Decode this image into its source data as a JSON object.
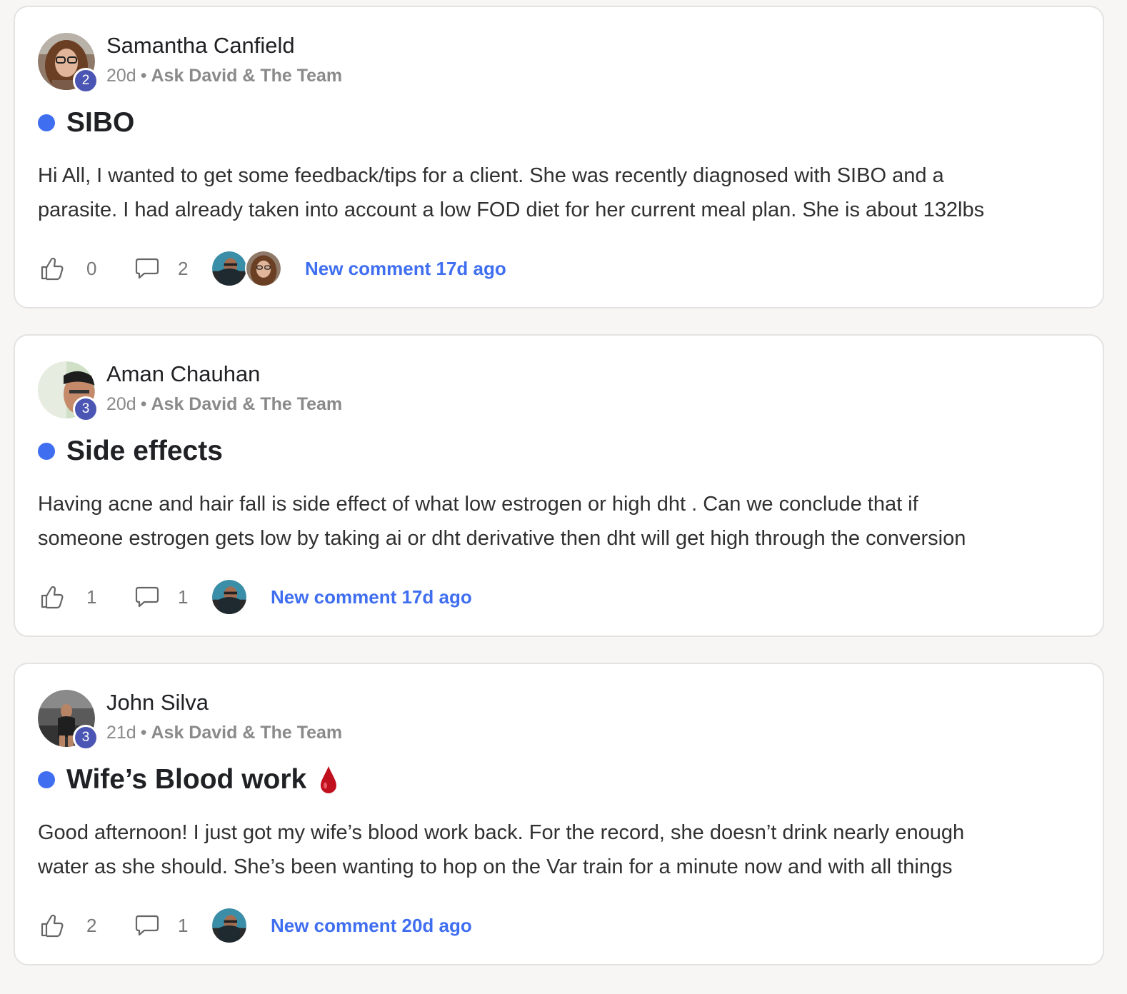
{
  "posts": [
    {
      "author": "Samantha Canfield",
      "level": "2",
      "age": "20d",
      "separator": "•",
      "category": "Ask David & The Team",
      "title": "SIBO",
      "title_emoji": "",
      "body_lines": [
        "Hi All, I wanted to get some feedback/tips for a client. She was recently diagnosed with SIBO and a",
        "parasite. I had already taken into account a low FOD diet for her current meal plan. She is about 132lbs"
      ],
      "likes": "0",
      "comments": "2",
      "commenter_avatars": [
        "avatar-david",
        "avatar-samantha"
      ],
      "new_comment": "New comment 17d ago"
    },
    {
      "author": "Aman Chauhan",
      "level": "3",
      "age": "20d",
      "separator": "•",
      "category": "Ask David & The Team",
      "title": "Side effects",
      "title_emoji": "",
      "body_lines": [
        "Having acne and hair fall is side effect of what low estrogen or high dht . Can we conclude that if",
        "someone estrogen gets low by taking ai or dht derivative then dht will get high through the conversion"
      ],
      "likes": "1",
      "comments": "1",
      "commenter_avatars": [
        "avatar-david"
      ],
      "new_comment": "New comment 17d ago"
    },
    {
      "author": "John Silva",
      "level": "3",
      "age": "21d",
      "separator": "•",
      "category": "Ask David & The Team",
      "title": "Wife’s Blood work",
      "title_emoji": "blood-drop-icon",
      "body_lines": [
        "Good afternoon! I just got my wife’s blood work back. For the record, she doesn’t drink nearly enough",
        "water as she should. She’s been wanting to hop on the Var train for a minute now and with all things"
      ],
      "likes": "2",
      "comments": "1",
      "commenter_avatars": [
        "avatar-david"
      ],
      "new_comment": "New comment 20d ago"
    }
  ],
  "colors": {
    "accent": "#3f6ef0",
    "level_badge": "#4b55b4",
    "unread_dot": "#3f6ef0",
    "blood_drop": "#c0101e"
  }
}
